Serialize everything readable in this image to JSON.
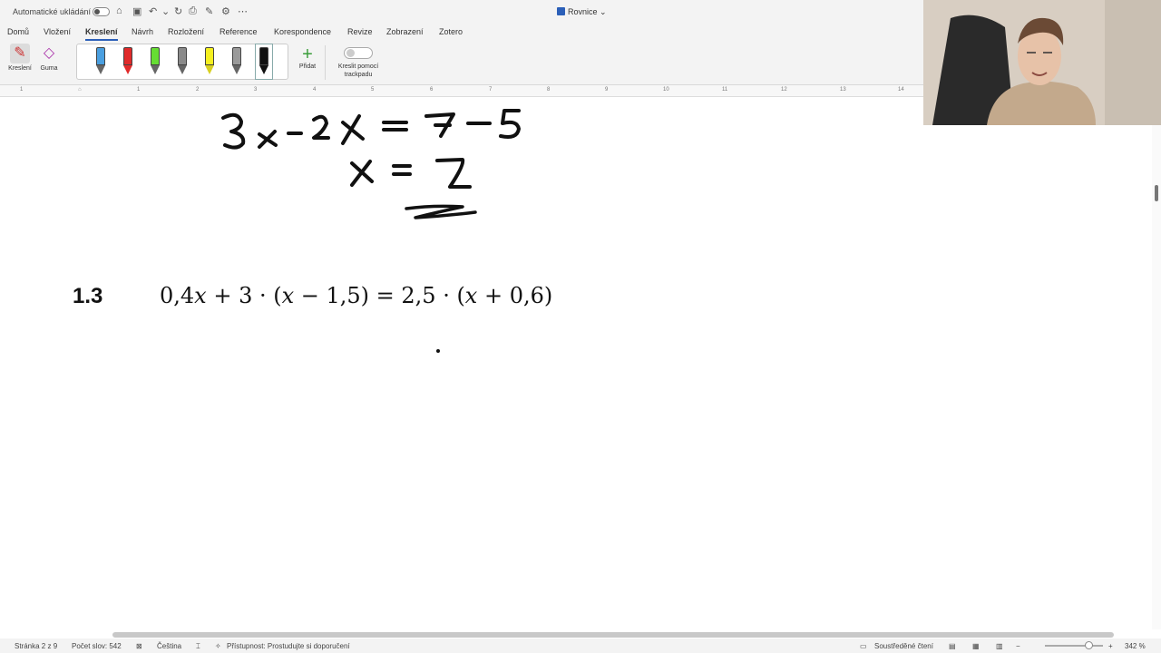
{
  "titlebar": {
    "autosave_label": "Automatické ukládání",
    "doc_title": "Rovnice"
  },
  "menu": {
    "tabs": [
      "Domů",
      "Vložení",
      "Kreslení",
      "Návrh",
      "Rozložení",
      "Reference",
      "Korespondence",
      "Revize",
      "Zobrazení",
      "Zotero"
    ],
    "active": "Kreslení"
  },
  "ribbon": {
    "draw_label": "Kreslení",
    "eraser_label": "Guma",
    "add_label": "Přidat",
    "trackpad_label": "Kreslit pomocí trackpadu",
    "trackpad_toggle_text": "O",
    "pens": [
      {
        "name": "blue-pen",
        "color": "#4a9fe0"
      },
      {
        "name": "red-pen",
        "color": "#e02a2a"
      },
      {
        "name": "green-pen",
        "color": "#66dd33"
      },
      {
        "name": "gray-pen",
        "color": "#8a8a8a"
      },
      {
        "name": "yellow-highlighter",
        "color": "#f5f020"
      },
      {
        "name": "gray-pencil",
        "color": "#9a9a9a"
      },
      {
        "name": "black-pen",
        "color": "#111111"
      }
    ]
  },
  "ruler": {
    "numbers": [
      "1",
      "1",
      "2",
      "3",
      "4",
      "5",
      "6",
      "7",
      "8",
      "9",
      "10",
      "11",
      "12",
      "13",
      "14"
    ]
  },
  "document": {
    "handwritten_line1": "3x - 2x = 7 - 5",
    "handwritten_line2": "x = 2",
    "exercise_number": "1.3",
    "equation": "0,4𝑥 + 3 · (𝑥 − 1,5) = 2,5 · (𝑥 + 0,6)"
  },
  "statusbar": {
    "page": "Stránka 2 z 9",
    "words": "Počet slov: 542",
    "language": "Čeština",
    "accessibility": "Přístupnost: Prostudujte si doporučení",
    "focus": "Soustředěné čtení",
    "zoom": "342 %"
  },
  "colors": {
    "accent": "#2b5fb8",
    "ink": "#111111"
  }
}
